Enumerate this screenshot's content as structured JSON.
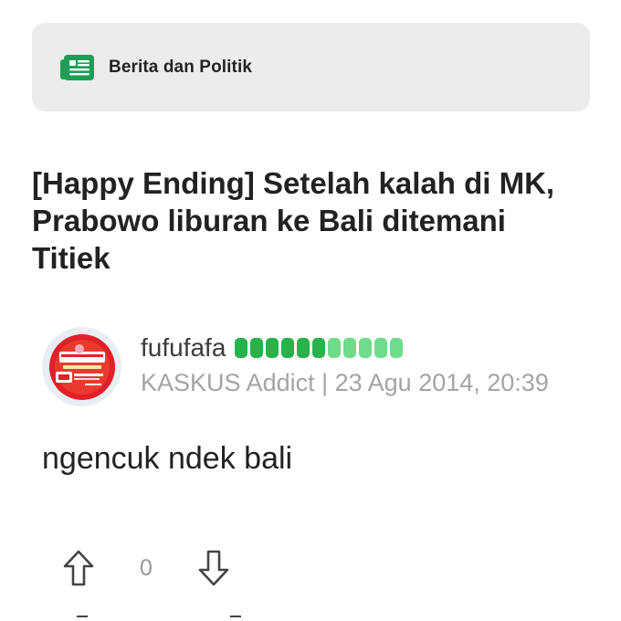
{
  "category": {
    "label": "Berita dan Politik",
    "icon": "newspaper-icon",
    "icon_color": "#1f9d55"
  },
  "thread": {
    "title": "[Happy Ending] Setelah kalah di MK, Prabowo liburan ke Bali ditemani Titiek"
  },
  "post": {
    "author": {
      "username": "fufufafa",
      "avatar": "avatar-image",
      "reputation": {
        "pips_dark": 6,
        "pips_light": 5,
        "dark_color": "#27b24a",
        "light_color": "#6fdc8c"
      },
      "meta": "KASKUS Addict | 23 Agu 2014, 20:39"
    },
    "body": "ngencuk ndek bali",
    "votes": {
      "count": "0",
      "upvote_icon": "arrow-up-icon",
      "downvote_icon": "arrow-down-icon"
    }
  }
}
